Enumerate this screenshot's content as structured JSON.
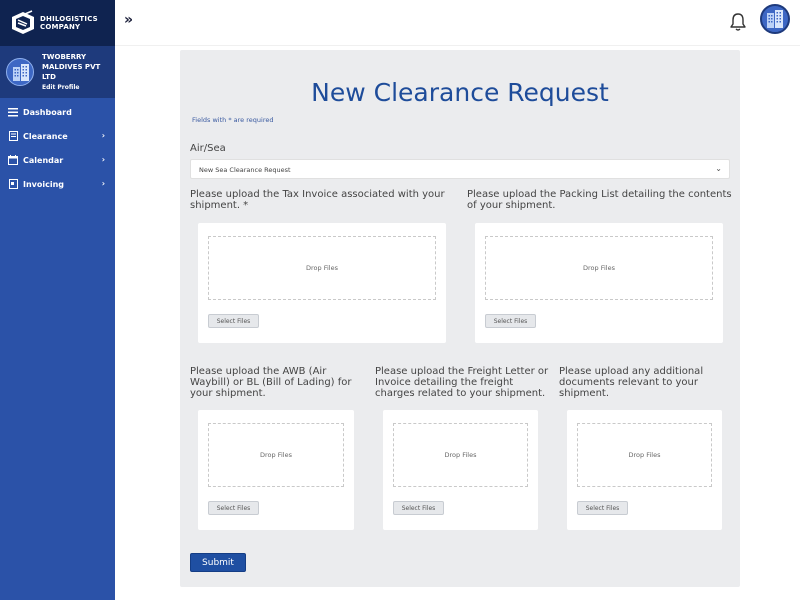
{
  "brand": {
    "line1": "DHILOGISTICS",
    "line2": "COMPANY",
    "logo_icon": "box-logo-icon"
  },
  "company": {
    "name": "TWOBERRY MALDIVES PVT LTD",
    "edit_profile": "Edit Profile"
  },
  "sidebar": {
    "items": [
      {
        "label": "Dashboard",
        "icon": "menu-icon",
        "has_submenu": false
      },
      {
        "label": "Clearance",
        "icon": "document-icon",
        "has_submenu": true
      },
      {
        "label": "Calendar",
        "icon": "calendar-icon",
        "has_submenu": true
      },
      {
        "label": "Invoicing",
        "icon": "invoice-icon",
        "has_submenu": true
      }
    ]
  },
  "topbar": {
    "collapse_label": "»",
    "bell_icon": "bell-icon"
  },
  "form": {
    "title": "New Clearance Request",
    "required_note_prefix": "Fields with",
    "required_note_star": "*",
    "required_note_suffix": "are required",
    "airsea_label": "Air/Sea",
    "airsea_value": "New Sea Clearance Request",
    "uploads": [
      {
        "question": "Please upload the Tax Invoice associated with your shipment. *",
        "drop": "Drop Files",
        "button": "Select Files"
      },
      {
        "question": "Please upload the Packing List detailing the contents of your shipment.",
        "drop": "Drop Files",
        "button": "Select Files"
      },
      {
        "question": "Please upload the AWB (Air Waybill) or BL (Bill of Lading) for your shipment.",
        "drop": "Drop Files",
        "button": "Select Files"
      },
      {
        "question": "Please upload the Freight Letter or Invoice detailing the freight charges related to your shipment.",
        "drop": "Drop Files",
        "button": "Select Files"
      },
      {
        "question": "Please upload any additional documents relevant to your shipment.",
        "drop": "Drop Files",
        "button": "Select Files"
      }
    ],
    "submit_label": "Submit"
  },
  "colors": {
    "sidebar": "#2b52a8",
    "sidebar_dark": "#0f2350",
    "accent": "#1e4c9a",
    "card_bg": "#ebecee"
  }
}
